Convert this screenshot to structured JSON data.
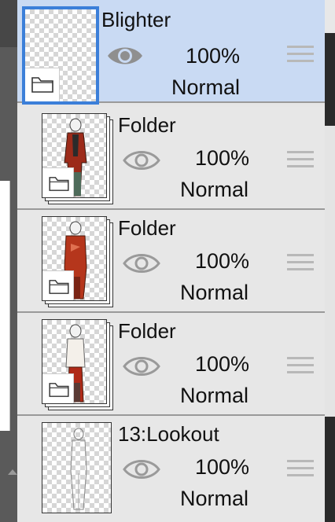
{
  "layers": [
    {
      "name": "Blighter",
      "opacity": "100%",
      "blend": "Normal",
      "selected": true,
      "thumbnail": "empty-checker"
    },
    {
      "name": "Folder",
      "opacity": "100%",
      "blend": "Normal",
      "selected": false,
      "thumbnail": "figure-red-jacket"
    },
    {
      "name": "Folder",
      "opacity": "100%",
      "blend": "Normal",
      "selected": false,
      "thumbnail": "figure-red-coat"
    },
    {
      "name": "Folder",
      "opacity": "100%",
      "blend": "Normal",
      "selected": false,
      "thumbnail": "figure-red-pants"
    },
    {
      "name": "13:Lookout",
      "opacity": "100%",
      "blend": "Normal",
      "selected": false,
      "thumbnail": "figure-lineart"
    }
  ],
  "icons": {
    "visibility": "eye-icon",
    "folder": "folder-icon",
    "drag": "drag-handle-icon"
  },
  "colors": {
    "selected_bg": "#c9daf3",
    "selected_border": "#3b7fd9",
    "row_bg": "#e7e7e7"
  }
}
